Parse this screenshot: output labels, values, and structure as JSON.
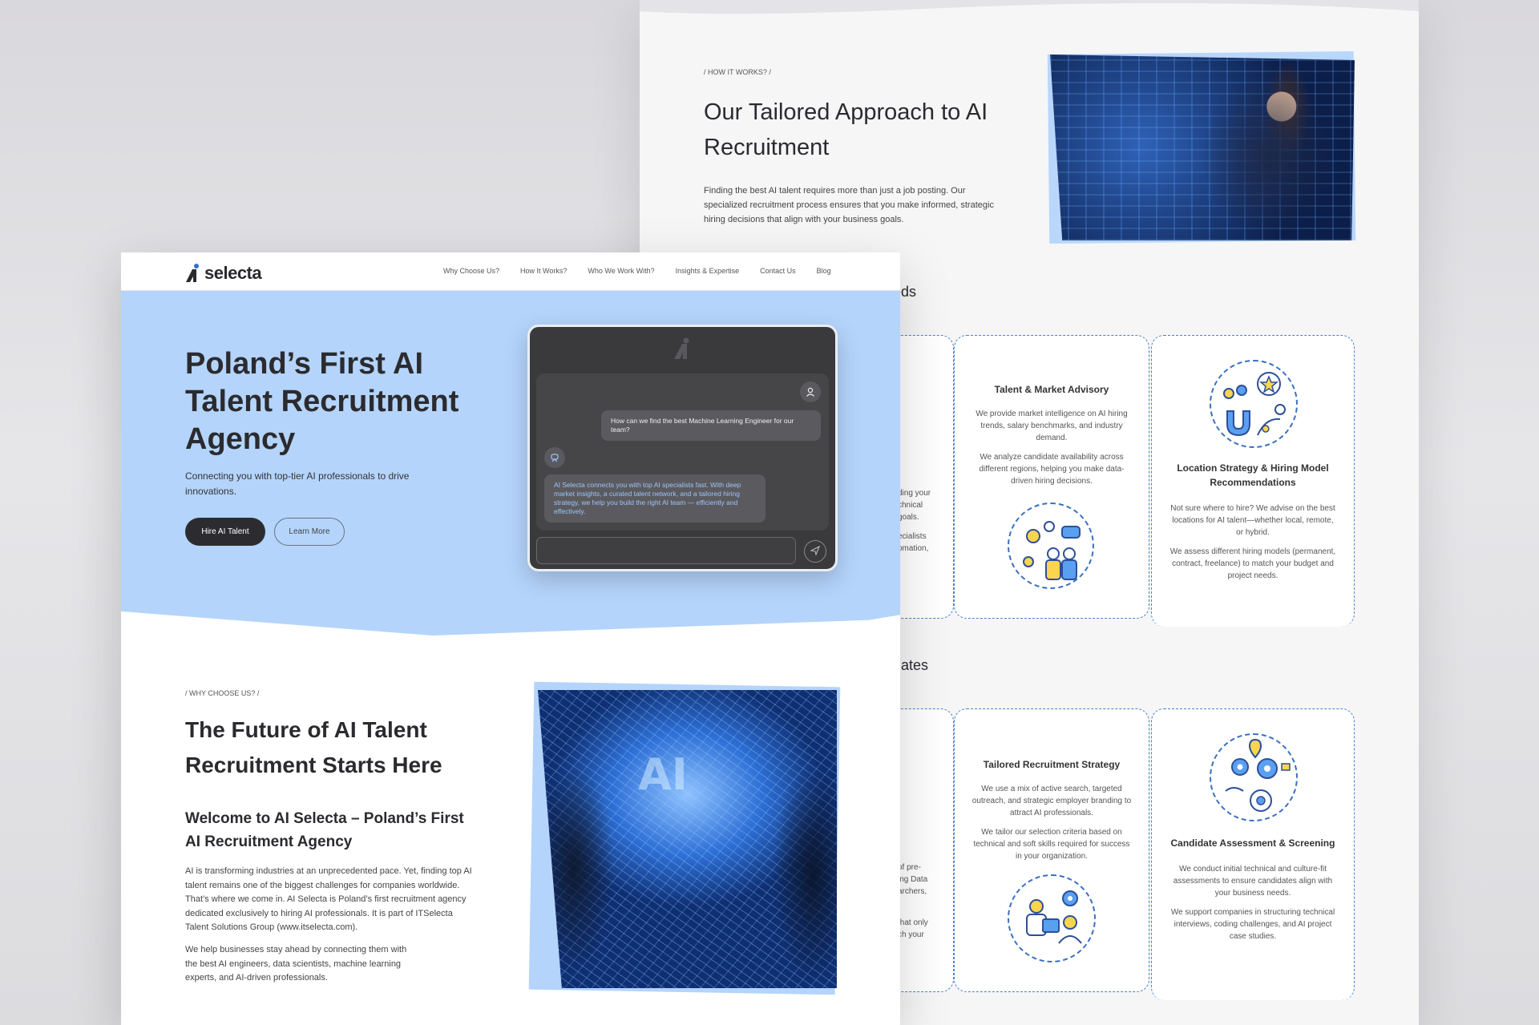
{
  "back_page": {
    "label": "/ HOW IT WORKS? /",
    "title": "Our Tailored Approach to AI Recruitment",
    "text": "Finding the best AI talent requires more than just a job posting. Our specialized recruitment process ensures that you make informed, strategic hiring decisions that align with your business goals.",
    "section_fragment_1": "eds",
    "section_fragment_2": "dates",
    "cut_texts": {
      "a1": "ding your",
      "a2": "chnical",
      "a3": "goals.",
      "a4": "ecialists",
      "a5": "omation,",
      "b1": "of pre-",
      "b2": "ing Data",
      "b3": "archers,",
      "b4": "that only",
      "b5": "ch your"
    },
    "cards": [
      {
        "title": "Talent & Market Advisory",
        "p1": "We provide market intelligence on AI hiring trends, salary benchmarks, and industry demand.",
        "p2": "We analyze candidate availability across different regions, helping you make data-driven hiring decisions.",
        "icon": "team-analysis-icon"
      },
      {
        "title": "Location Strategy & Hiring Model Recommendations",
        "p1": "Not sure where to hire? We advise on the best locations for AI talent—whether local, remote, or hybrid.",
        "p2": "We assess different hiring models (permanent, contract, freelance) to match your budget and project needs.",
        "icon": "talent-magnet-icon"
      },
      {
        "title": "Tailored Recruitment Strategy",
        "p1": "We use a mix of active search, targeted outreach, and strategic employer branding to attract AI professionals.",
        "p2": "We tailor our selection criteria based on technical and soft skills required for success in your organization.",
        "icon": "recruiter-settings-icon"
      },
      {
        "title": "Candidate Assessment & Screening",
        "p1": "We conduct initial technical and culture-fit assessments to ensure candidates align with your business needs.",
        "p2": "We support companies in structuring technical interviews, coding challenges, and AI project case studies.",
        "icon": "gears-eye-icon"
      }
    ]
  },
  "front_page": {
    "logo_text": "selecta",
    "nav": [
      "Why Choose Us?",
      "How It Works?",
      "Who We Work With?",
      "Insights & Expertise",
      "Contact Us",
      "Blog"
    ],
    "hero": {
      "title": "Poland’s First AI Talent Recruitment Agency",
      "subtitle": "Connecting you with top-tier AI professionals to drive innovations.",
      "primary_button": "Hire AI Talent",
      "secondary_button": "Learn More"
    },
    "chat": {
      "user_message": "How can we find the best Machine Learning Engineer for our team?",
      "bot_message": "AI Selecta connects you with top AI specialists fast. With deep market insights, a curated talent network, and a tailored hiring strategy, we help you build the right AI team — efficiently and effectively.",
      "input_value": ""
    },
    "why": {
      "label": "/ WHY CHOOSE US? /",
      "title": "The Future of AI Talent Recruitment Starts Here",
      "subtitle": "Welcome to AI Selecta – Poland’s First AI Recruitment Agency",
      "p1": "AI is transforming industries at an unprecedented pace. Yet, finding top AI talent remains one of the biggest challenges for companies worldwide. That’s where we come in. AI Selecta is Poland’s first recruitment agency dedicated exclusively to hiring AI professionals. It is part of ITSelecta Talent Solutions Group (www.itselecta.com).",
      "p2": "We help businesses stay ahead by connecting them with the best AI engineers, data scientists, machine learning experts, and AI-driven professionals.",
      "photo_text": "AI"
    }
  },
  "colors": {
    "hero_bg": "#b4d4fb",
    "accent_blue": "#3a6fc2",
    "dark": "#2c2c30",
    "page_bg": "#f6f6f7"
  }
}
